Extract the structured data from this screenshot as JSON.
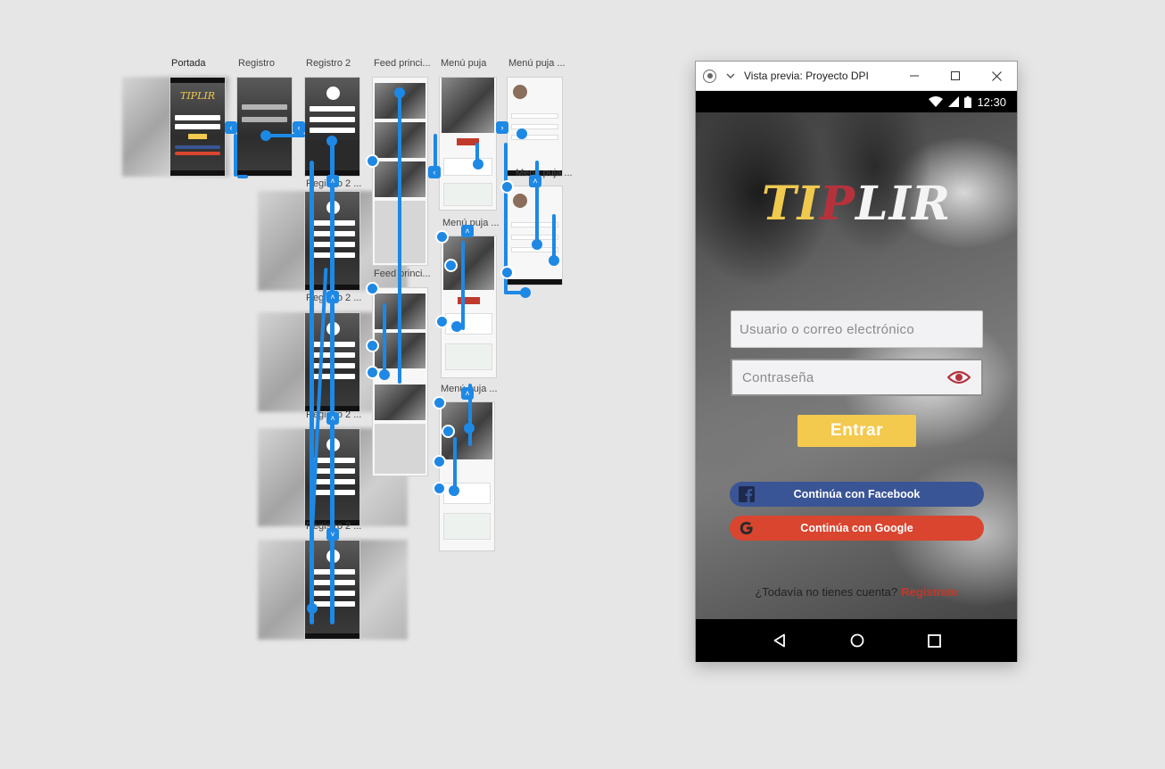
{
  "artboards": {
    "labels": [
      "Portada",
      "Registro",
      "Registro  2",
      "Feed princi...",
      "Menú puja",
      "Menú puja ..."
    ],
    "sub_labels": {
      "registro_2_b": "Registro  2 ...",
      "registro_2_c": "Registro  2 ...",
      "registro_2_d": "Registro  2 ...",
      "registro_2_e": "Registro  2 ...",
      "feed_b": "Feed princi...",
      "menu_puja_b": "Menú puja ...",
      "menu_puja_c": "Menú puja ...",
      "menu_puja_d": "Menú puja ..."
    },
    "mini_logo": "TIPLIR"
  },
  "preview_window": {
    "title": "Vista previa: Proyecto DPI",
    "status_time": "12:30"
  },
  "app": {
    "logo_parts": [
      "TI",
      "P",
      "LIR"
    ],
    "username_placeholder": "Usuario o correo electrónico",
    "password_placeholder": "Contraseña",
    "enter_label": "Entrar",
    "facebook_label": "Continúa con Facebook",
    "google_label": "Continúa con Google",
    "signup_prompt": "¿Todavía no tienes cuenta?",
    "signup_link": "Regístrate"
  },
  "colors": {
    "accent_yellow": "#f3c94e",
    "accent_red": "#b5323d",
    "facebook_blue": "#3a5596",
    "google_red": "#d9452f",
    "wire_blue": "#1e88e5"
  }
}
